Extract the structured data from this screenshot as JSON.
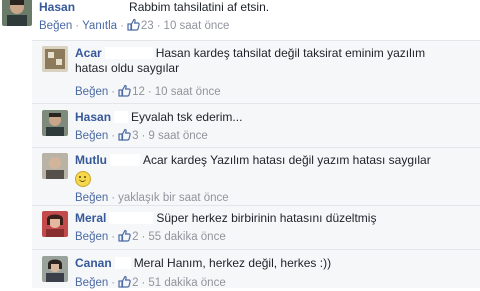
{
  "comments": [
    {
      "author": "Hasan",
      "text": "Rabbim tahsilatini af etsin.",
      "like_label": "Beğen",
      "reply_label": "Yanıtla",
      "like_count": "23",
      "time": "10 saat önce"
    },
    {
      "author": "Acar",
      "text": "Hasan kardeş tahsilat değil taksirat eminim yazılım",
      "text_line2": "hatası oldu saygılar",
      "like_label": "Beğen",
      "like_count": "12",
      "time": "10 saat önce"
    },
    {
      "author": "Hasan",
      "text": "Eyvalah tsk ederim...",
      "like_label": "Beğen",
      "like_count": "3",
      "time": "9 saat önce"
    },
    {
      "author": "Mutlu",
      "text": "Acar kardeş Yazılım hatası değil yazım hatası saygılar",
      "like_label": "Beğen",
      "time": "yaklaşık bir saat önce"
    },
    {
      "author": "Meral",
      "text": "Süper herkez birbirinin hatasını düzeltmiş",
      "like_label": "Beğen",
      "like_count": "2",
      "time": "55 dakika önce"
    },
    {
      "author": "Canan",
      "text": "Meral Hanım, herkez değil, herkes :))",
      "like_label": "Beğen",
      "like_count": "2",
      "time": "51 dakika önce"
    }
  ]
}
